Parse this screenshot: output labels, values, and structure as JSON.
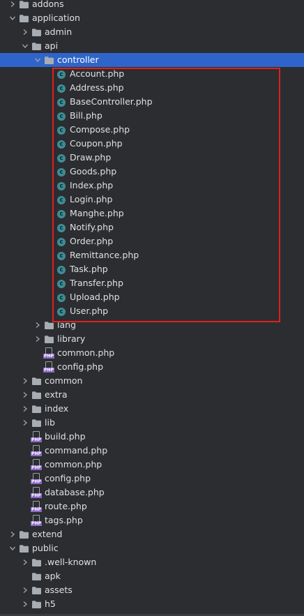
{
  "tree": [
    {
      "label": "addons",
      "type": "folder",
      "depth": 1,
      "expanded": false
    },
    {
      "label": "application",
      "type": "folder",
      "depth": 1,
      "expanded": true
    },
    {
      "label": "admin",
      "type": "folder",
      "depth": 2,
      "expanded": false
    },
    {
      "label": "api",
      "type": "folder",
      "depth": 2,
      "expanded": true
    },
    {
      "label": "controller",
      "type": "folder",
      "depth": 3,
      "expanded": true,
      "selected": true
    },
    {
      "label": "Account.php",
      "type": "php-class",
      "depth": 4
    },
    {
      "label": "Address.php",
      "type": "php-class",
      "depth": 4
    },
    {
      "label": "BaseController.php",
      "type": "php-class",
      "depth": 4
    },
    {
      "label": "Bill.php",
      "type": "php-class",
      "depth": 4
    },
    {
      "label": "Compose.php",
      "type": "php-class",
      "depth": 4
    },
    {
      "label": "Coupon.php",
      "type": "php-class",
      "depth": 4
    },
    {
      "label": "Draw.php",
      "type": "php-class",
      "depth": 4
    },
    {
      "label": "Goods.php",
      "type": "php-class",
      "depth": 4
    },
    {
      "label": "Index.php",
      "type": "php-class",
      "depth": 4
    },
    {
      "label": "Login.php",
      "type": "php-class",
      "depth": 4
    },
    {
      "label": "Manghe.php",
      "type": "php-class",
      "depth": 4
    },
    {
      "label": "Notify.php",
      "type": "php-class",
      "depth": 4
    },
    {
      "label": "Order.php",
      "type": "php-class",
      "depth": 4
    },
    {
      "label": "Remittance.php",
      "type": "php-class",
      "depth": 4
    },
    {
      "label": "Task.php",
      "type": "php-class",
      "depth": 4
    },
    {
      "label": "Transfer.php",
      "type": "php-class",
      "depth": 4
    },
    {
      "label": "Upload.php",
      "type": "php-class",
      "depth": 4
    },
    {
      "label": "User.php",
      "type": "php-class",
      "depth": 4
    },
    {
      "label": "lang",
      "type": "folder",
      "depth": 3,
      "expanded": false
    },
    {
      "label": "library",
      "type": "folder",
      "depth": 3,
      "expanded": false
    },
    {
      "label": "common.php",
      "type": "php-file",
      "depth": 3
    },
    {
      "label": "config.php",
      "type": "php-file",
      "depth": 3
    },
    {
      "label": "common",
      "type": "folder",
      "depth": 2,
      "expanded": false
    },
    {
      "label": "extra",
      "type": "folder",
      "depth": 2,
      "expanded": false
    },
    {
      "label": "index",
      "type": "folder",
      "depth": 2,
      "expanded": false
    },
    {
      "label": "lib",
      "type": "folder",
      "depth": 2,
      "expanded": false
    },
    {
      "label": "build.php",
      "type": "php-file",
      "depth": 2
    },
    {
      "label": "command.php",
      "type": "php-file",
      "depth": 2
    },
    {
      "label": "common.php",
      "type": "php-file",
      "depth": 2
    },
    {
      "label": "config.php",
      "type": "php-file",
      "depth": 2
    },
    {
      "label": "database.php",
      "type": "php-file",
      "depth": 2
    },
    {
      "label": "route.php",
      "type": "php-file",
      "depth": 2
    },
    {
      "label": "tags.php",
      "type": "php-file",
      "depth": 2
    },
    {
      "label": "extend",
      "type": "folder",
      "depth": 1,
      "expanded": false
    },
    {
      "label": "public",
      "type": "folder",
      "depth": 1,
      "expanded": true
    },
    {
      "label": ".well-known",
      "type": "folder",
      "depth": 2,
      "expanded": false
    },
    {
      "label": "apk",
      "type": "folder",
      "depth": 2,
      "leaf": true
    },
    {
      "label": "assets",
      "type": "folder",
      "depth": 2,
      "expanded": false
    },
    {
      "label": "h5",
      "type": "folder",
      "depth": 2,
      "expanded": false
    }
  ],
  "icon_text": {
    "php_class": "c",
    "php_file": "PHP"
  },
  "colors": {
    "background": "#2b2d30",
    "selection": "#2f65ca",
    "highlight_border": "#e02020",
    "folder": "#a8adb3",
    "php_class": "#3e8d95",
    "php_badge": "#8c67c8"
  }
}
